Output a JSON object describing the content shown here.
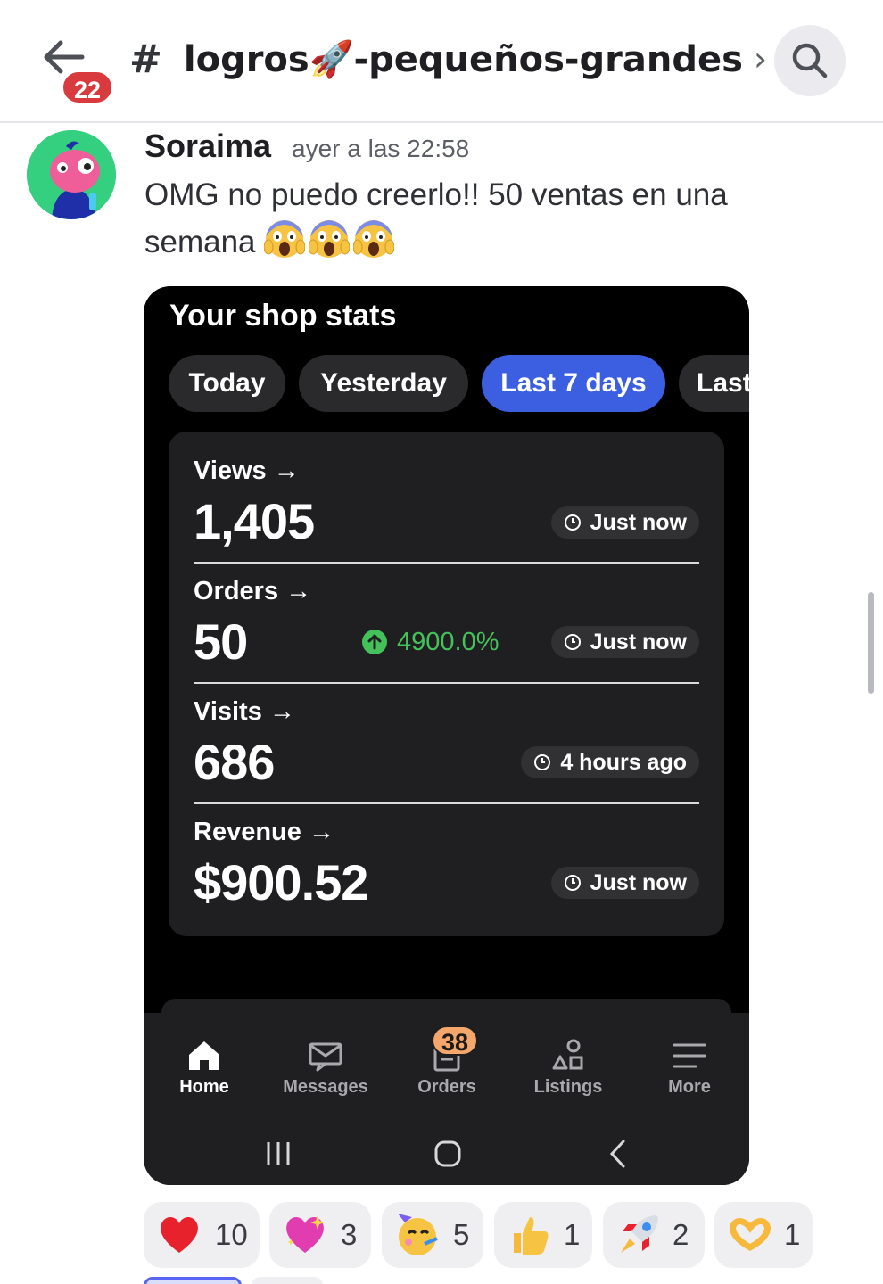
{
  "header": {
    "unread_count": "22",
    "channel_name": "logros🚀-pequeños-grandes",
    "chevron": "›",
    "icons": {
      "back": "arrow-left-icon",
      "search": "search-icon"
    }
  },
  "message": {
    "author": "Soraima",
    "timestamp": "ayer a las 22:58",
    "text": "OMG no puedo creerlo!! 50 ventas en una semana",
    "emojis": [
      "scream",
      "scream",
      "scream"
    ]
  },
  "shop_screenshot": {
    "title": "Your shop stats",
    "tabs": [
      {
        "label": "Today",
        "active": false
      },
      {
        "label": "Yesterday",
        "active": false
      },
      {
        "label": "Last 7 days",
        "active": true
      },
      {
        "label": "Last",
        "active": false
      }
    ],
    "stats": [
      {
        "label": "Views →",
        "value": "1,405",
        "updated": "Just now"
      },
      {
        "label": "Orders →",
        "value": "50",
        "change": "4900.0%",
        "updated": "Just now"
      },
      {
        "label": "Visits →",
        "value": "686",
        "updated": "4 hours ago"
      },
      {
        "label": "Revenue →",
        "value": "$900.52",
        "updated": "Just now"
      }
    ],
    "bottom_nav": [
      {
        "label": "Home",
        "icon": "home-icon",
        "active": true
      },
      {
        "label": "Messages",
        "icon": "messages-icon",
        "active": false
      },
      {
        "label": "Orders",
        "icon": "orders-icon",
        "active": false,
        "badge": "38"
      },
      {
        "label": "Listings",
        "icon": "listings-icon",
        "active": false
      },
      {
        "label": "More",
        "icon": "menu-icon",
        "active": false
      }
    ],
    "accent_color": "#3b5fe0",
    "positive_color": "#43c25c"
  },
  "reactions": [
    {
      "emoji": "red-heart",
      "count": "10"
    },
    {
      "emoji": "sparkling-heart",
      "count": "3"
    },
    {
      "emoji": "partying-face",
      "count": "5"
    },
    {
      "emoji": "thumbs-up",
      "count": "1"
    },
    {
      "emoji": "rocket",
      "count": "2"
    },
    {
      "emoji": "heart-hands",
      "count": "1"
    }
  ]
}
